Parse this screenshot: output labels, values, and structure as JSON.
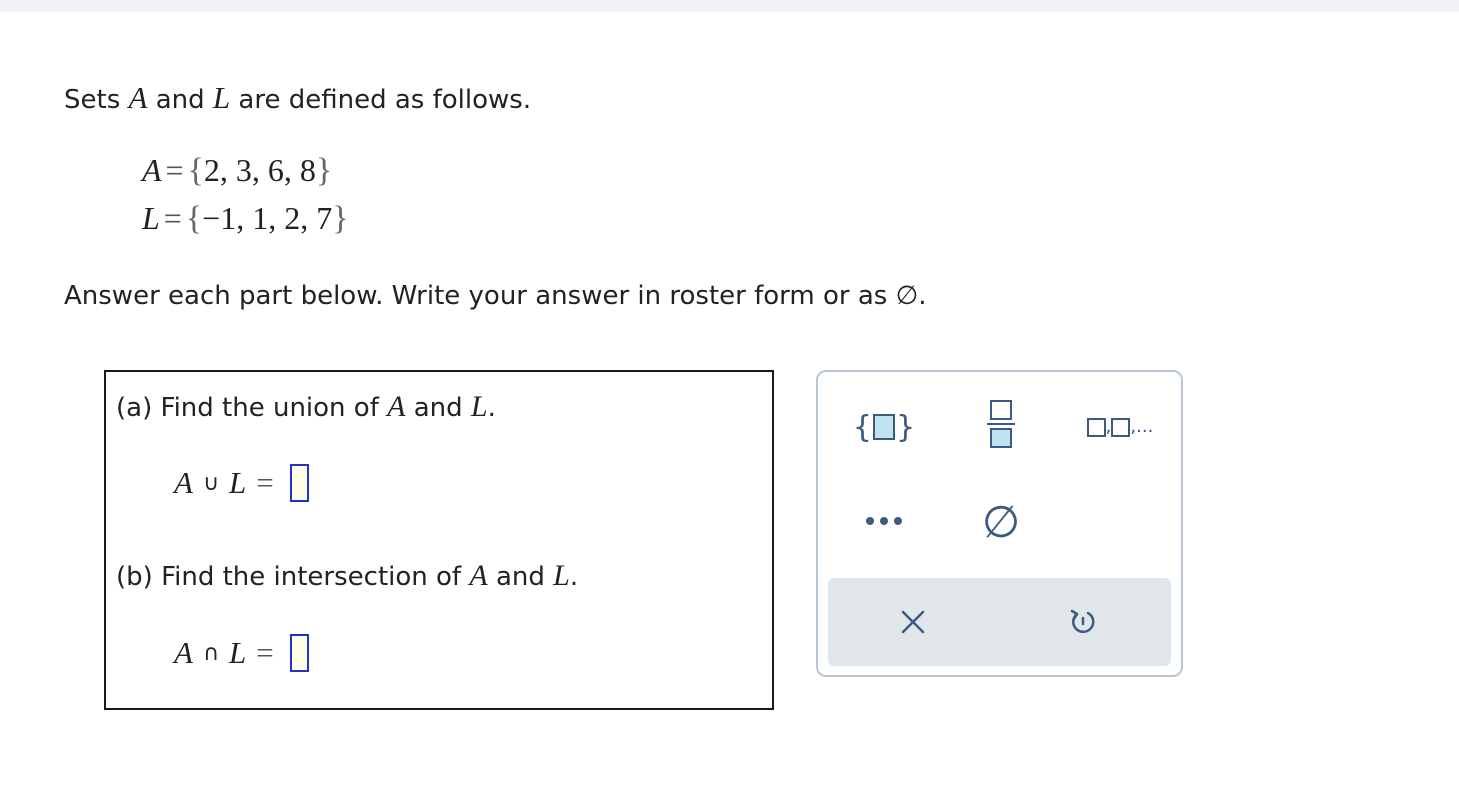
{
  "intro": {
    "prefix": "Sets",
    "var_a": "A",
    "conj": "and",
    "var_l": "L",
    "suffix": "are defined as follows."
  },
  "sets": {
    "a": {
      "name": "A",
      "open": "{",
      "elements": "2, 3, 6, 8",
      "close": "}"
    },
    "l": {
      "name": "L",
      "open": "{",
      "elements": "−1, 1, 2, 7",
      "close": "}"
    }
  },
  "equals": "=",
  "instructions": "Answer each part below. Write your answer in roster form or as ∅.",
  "parts": [
    {
      "label": "(a)",
      "prompt_before": "Find the union of",
      "var_a": "A",
      "conj": "and",
      "var_l": "L",
      "end": ".",
      "expr_left": "A",
      "operator": "∪",
      "expr_right": "L",
      "answer_value": ""
    },
    {
      "label": "(b)",
      "prompt_before": "Find the intersection of",
      "var_a": "A",
      "conj": "and",
      "var_l": "L",
      "end": ".",
      "expr_left": "A",
      "operator": "∩",
      "expr_right": "L",
      "answer_value": ""
    }
  ],
  "palette": {
    "set_brace_open": "{",
    "set_brace_close": "}",
    "list_separator": ",",
    "list_ellipsis": "...",
    "empty_set": "∅",
    "icons": [
      "set-braces-icon",
      "fraction-icon",
      "list-icon",
      "ellipsis-icon",
      "empty-set-icon",
      "clear-icon",
      "undo-icon"
    ]
  },
  "colors": {
    "input_border": "#2233cc",
    "input_fill": "#fffde6",
    "palette_border": "#b9c6d3",
    "palette_icon": "#3d5a80",
    "palette_footer": "#e1e6ea"
  }
}
